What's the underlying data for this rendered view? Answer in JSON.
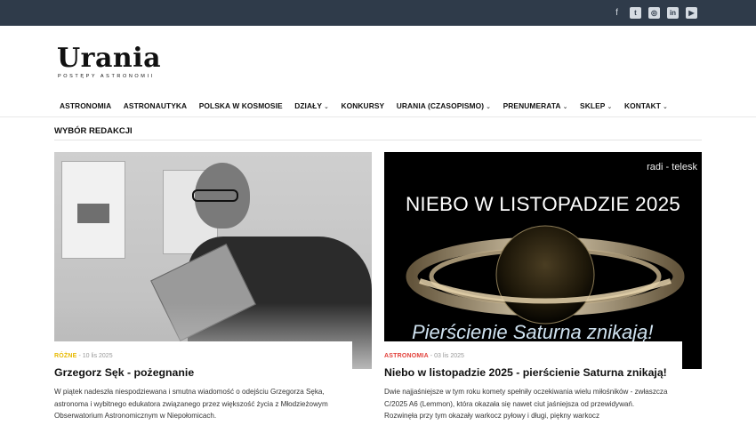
{
  "social_icons": [
    "facebook-icon",
    "twitter-icon",
    "instagram-icon",
    "linkedin-icon",
    "youtube-icon"
  ],
  "logo": {
    "title": "Urania",
    "subtitle": "POSTĘPY ASTRONOMII"
  },
  "nav": [
    {
      "label": "ASTRONOMIA",
      "dropdown": false
    },
    {
      "label": "ASTRONAUTYKA",
      "dropdown": false
    },
    {
      "label": "POLSKA W KOSMOSIE",
      "dropdown": false
    },
    {
      "label": "DZIAŁY",
      "dropdown": true
    },
    {
      "label": "KONKURSY",
      "dropdown": false
    },
    {
      "label": "URANIA (CZASOPISMO)",
      "dropdown": true
    },
    {
      "label": "PRENUMERATA",
      "dropdown": true
    },
    {
      "label": "SKLEP",
      "dropdown": true
    },
    {
      "label": "KONTAKT",
      "dropdown": true
    }
  ],
  "section": {
    "title": "WYBÓR REDAKCJI"
  },
  "cards": [
    {
      "category": "RÓŻNE",
      "category_color": "#e7b900",
      "date": "10 lis 2025",
      "title": "Grzegorz Sęk - pożegnanie",
      "text": "W piątek nadeszła niespodziewana i smutna wiadomość o odejściu Grzegorza Sęka, astronoma i wybitnego edukatora związanego przez większość życia z Młodzieżowym Obserwatorium Astronomicznym w Niepołomicach."
    },
    {
      "category": "ASTRONOMIA",
      "category_color": "#e2403a",
      "date": "03 lis 2025",
      "title": "Niebo w listopadzie 2025 - pierścienie Saturna znikają!",
      "text": "Dwie najjaśniejsze w tym roku komety spełniły oczekiwania wielu miłośników - zwłaszcza C/2025 A6 (Lemmon), która okazała się nawet ciut jaśniejsza od przewidywań. Rozwinęła przy tym okazały warkocz pyłowy i długi, piękny warkocz",
      "image_title": "NIEBO W LISTOPADZIE 2025",
      "image_brand": "radi - telesk",
      "image_caption": "Pierścienie Saturna znikają!"
    }
  ]
}
